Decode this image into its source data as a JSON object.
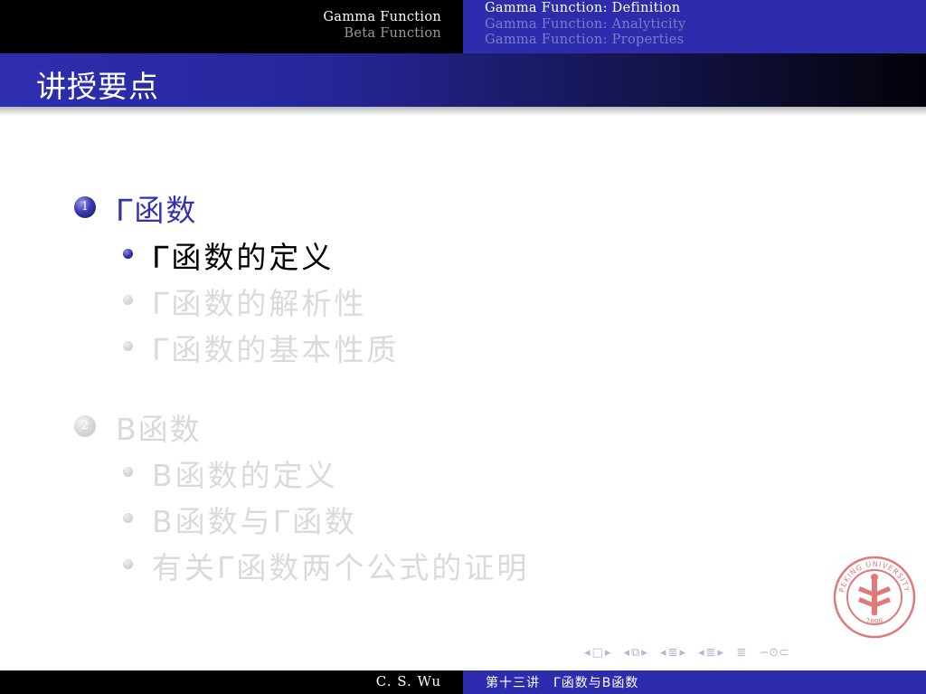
{
  "header": {
    "sections": [
      {
        "label": "Gamma Function",
        "active": true
      },
      {
        "label": "Beta Function",
        "active": false
      }
    ],
    "subsections": [
      {
        "label": "Gamma Function: Definition",
        "active": true
      },
      {
        "label": "Gamma Function: Analyticity",
        "active": false
      },
      {
        "label": "Gamma Function: Properties",
        "active": false
      }
    ]
  },
  "frame": {
    "title": "讲授要点"
  },
  "outline": {
    "sections": [
      {
        "number": "1",
        "label": "Γ函数",
        "active": true,
        "items": [
          {
            "label": "Γ函数的定义",
            "active": true
          },
          {
            "label": "Γ函数的解析性",
            "active": false
          },
          {
            "label": "Γ函数的基本性质",
            "active": false
          }
        ]
      },
      {
        "number": "2",
        "label": "B函数",
        "active": false,
        "items": [
          {
            "label": "B函数的定义",
            "active": false
          },
          {
            "label": "B函数与Γ函数",
            "active": false
          },
          {
            "label": "有关Γ函数两个公式的证明",
            "active": false
          }
        ]
      }
    ]
  },
  "logo": {
    "name": "peking-university-seal",
    "text": "PEKING UNIVERSITY",
    "year": "1898",
    "color": "#e07a7a"
  },
  "nav_symbols": {
    "frame_prev": "◂",
    "frame": "□",
    "frame_next": "▸",
    "subsection_prev": "◂",
    "subsection": "⧉",
    "subsection_next": "▸",
    "section_prev": "◂",
    "section": "≣",
    "section_next": "▸",
    "doc_prev": "◂",
    "doc": "≣",
    "doc_next": "▸",
    "appendix": "≣",
    "search": "∽⊙⊂"
  },
  "footer": {
    "author": "C. S. Wu",
    "lecture": "第十三讲　Γ函数与B函数"
  },
  "colors": {
    "structure_blue": "#2c2cad",
    "active_section": "#3333b2",
    "dimmed": "#d9d9d9"
  }
}
